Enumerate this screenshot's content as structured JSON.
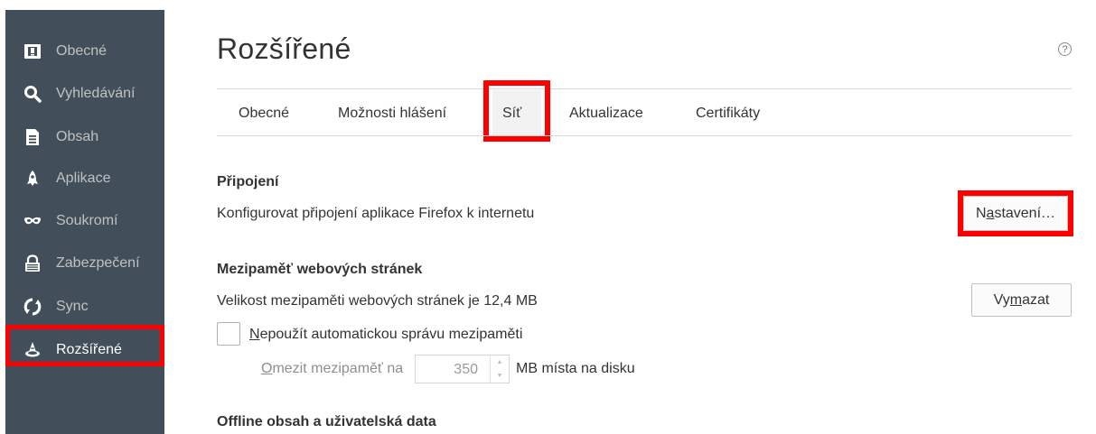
{
  "sidebar": {
    "items": [
      {
        "label": "Obecné",
        "icon": "general-icon"
      },
      {
        "label": "Vyhledávání",
        "icon": "search-icon"
      },
      {
        "label": "Obsah",
        "icon": "document-icon"
      },
      {
        "label": "Aplikace",
        "icon": "rocket-icon"
      },
      {
        "label": "Soukromí",
        "icon": "mask-icon"
      },
      {
        "label": "Zabezpečení",
        "icon": "lock-icon"
      },
      {
        "label": "Sync",
        "icon": "sync-icon"
      },
      {
        "label": "Rozšířené",
        "icon": "wizard-hat-icon",
        "selected": true
      }
    ]
  },
  "page": {
    "title": "Rozšířené",
    "help": "?"
  },
  "tabs": [
    {
      "label": "Obecné"
    },
    {
      "label": "Možnosti hlášení"
    },
    {
      "label": "Síť",
      "selected": true
    },
    {
      "label": "Aktualizace"
    },
    {
      "label": "Certifikáty"
    }
  ],
  "connection": {
    "heading": "Připojení",
    "description": "Konfigurovat připojení aplikace Firefox k internetu",
    "button_pre": "N",
    "button_accel": "a",
    "button_post": "stavení…"
  },
  "cache": {
    "heading": "Mezipaměť webových stránek",
    "size_text": "Velikost mezipaměti webových stránek je 12,4 MB",
    "clear_pre": "Vy",
    "clear_accel": "m",
    "clear_post": "azat",
    "override_accel": "N",
    "override_rest": "epoužít automatickou správu mezipaměti",
    "limit_accel": "O",
    "limit_rest": "mezit mezipaměť na",
    "limit_value": "350",
    "limit_unit": "MB místa na disku"
  },
  "offline": {
    "heading": "Offline obsah a uživatelská data"
  },
  "colors": {
    "sidebar_bg": "#424f5a",
    "highlight": "#ff0000"
  }
}
